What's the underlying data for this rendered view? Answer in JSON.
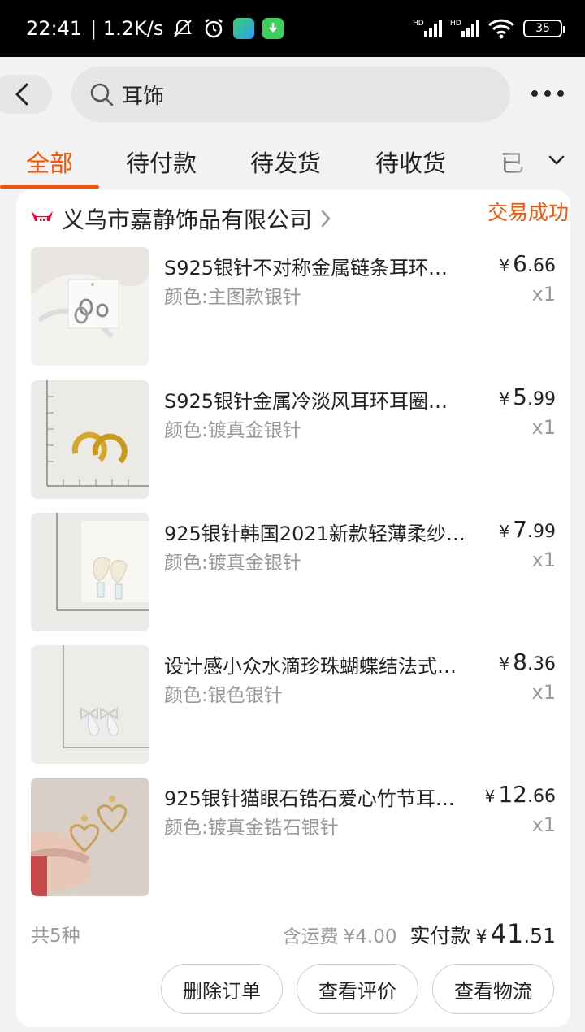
{
  "status_bar": {
    "time": "22:41",
    "speed": "| 1.2K/s",
    "battery": "35",
    "icons": [
      "mute-icon",
      "alarm-icon",
      "app-badge-green",
      "download-icon",
      "hd-signal-1",
      "hd-signal-2",
      "wifi-icon",
      "battery-icon"
    ]
  },
  "header": {
    "search_text": "耳饰",
    "icons": [
      "back-icon",
      "search-icon",
      "more-icon"
    ]
  },
  "tabs": [
    {
      "label": "全部",
      "active": true
    },
    {
      "label": "待付款"
    },
    {
      "label": "待发货"
    },
    {
      "label": "待收货"
    },
    {
      "label": "已"
    }
  ],
  "order": {
    "store_name": "义乌市嘉静饰品有限公司",
    "status": "交易成功",
    "items": [
      {
        "title": "S925银针不对称金属链条耳环…",
        "sku": "颜色:主图款银针",
        "price_cur": "¥",
        "price_int": "6",
        "price_dec": ".66",
        "qty": "x1"
      },
      {
        "title": "S925银针金属冷淡风耳环耳圈…",
        "sku": "颜色:镀真金银针",
        "price_cur": "¥",
        "price_int": "5",
        "price_dec": ".99",
        "qty": "x1"
      },
      {
        "title": "925银针韩国2021新款轻薄柔纱…",
        "sku": "颜色:镀真金银针",
        "price_cur": "¥",
        "price_int": "7",
        "price_dec": ".99",
        "qty": "x1"
      },
      {
        "title": "设计感小众水滴珍珠蝴蝶结法式…",
        "sku": "颜色:银色银针",
        "price_cur": "¥",
        "price_int": "8",
        "price_dec": ".36",
        "qty": "x1"
      },
      {
        "title": "925银针猫眼石锆石爱心竹节耳…",
        "sku": "颜色:镀真金锆石银针",
        "price_cur": "¥",
        "price_int": "12",
        "price_dec": ".66",
        "qty": "x1"
      }
    ],
    "count_label": "共5种",
    "shipping_label": "含运费",
    "shipping_value": "¥4.00",
    "paid_label": "实付款",
    "paid_cur": "¥",
    "paid_int": "41",
    "paid_dec": ".51",
    "buttons": [
      "删除订单",
      "查看评价",
      "查看物流"
    ]
  },
  "colors": {
    "accent": "#ff5000",
    "muted": "#999999"
  }
}
